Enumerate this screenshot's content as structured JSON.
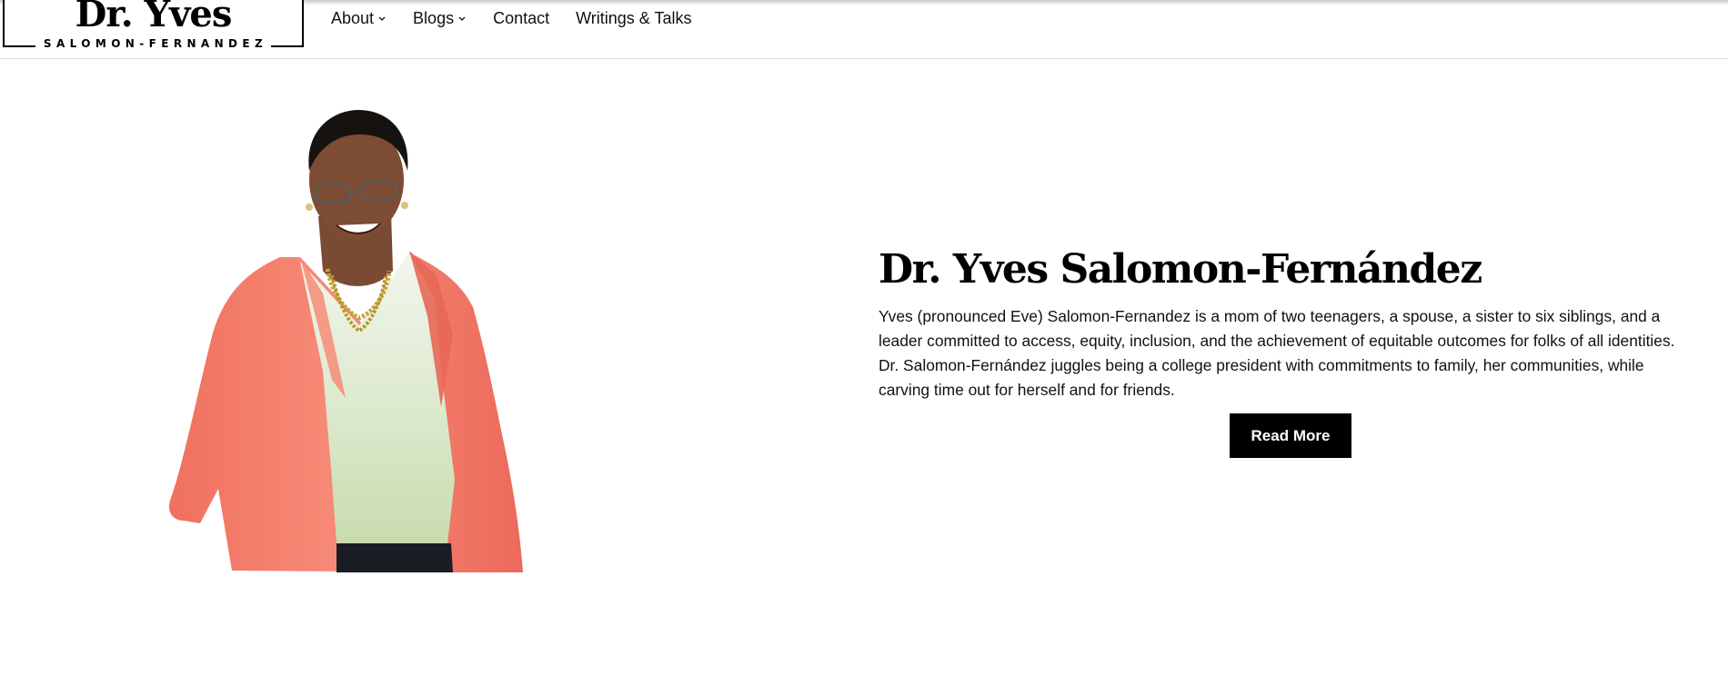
{
  "logo": {
    "name": "Dr. Yves",
    "surname": "SALOMON-FERNANDEZ"
  },
  "nav": {
    "about": "About",
    "blogs": "Blogs",
    "contact": "Contact",
    "writings": "Writings & Talks"
  },
  "hero": {
    "title": "Dr. Yves Salomon-Fernández",
    "bio": "Yves (pronounced Eve) Salomon-Fernandez is a mom of two teenagers, a spouse, a sister to six siblings, and a leader committed to access, equity, inclusion, and the achievement of equitable outcomes for folks of all identities. Dr. Salomon-Fernández juggles being a college president with commitments to family, her communities, while carving time out for herself and for friends.",
    "button": "Read More"
  },
  "colors": {
    "jacket": "#f2786a",
    "button_bg": "#000000"
  }
}
